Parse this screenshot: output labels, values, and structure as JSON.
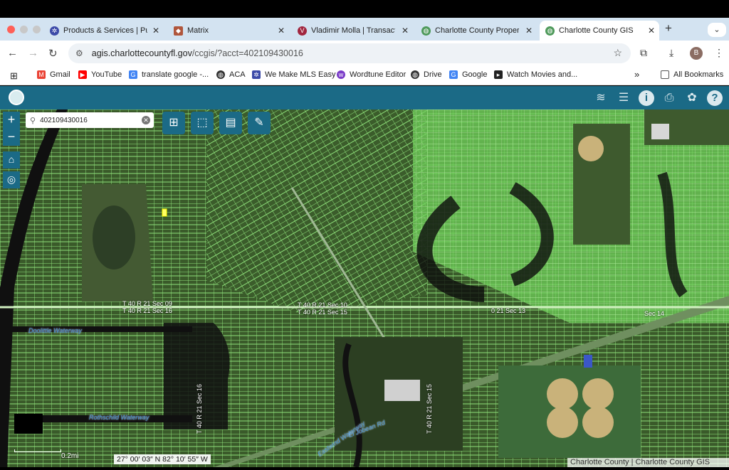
{
  "browser": {
    "tabs": [
      {
        "title": "Products & Services | Pun",
        "favicon": "gear-icon",
        "active": false
      },
      {
        "title": "Matrix",
        "favicon": "cube-icon",
        "active": false
      },
      {
        "title": "Vladimir Molla | Transactic",
        "favicon": "v-logo-icon",
        "active": false
      },
      {
        "title": "Charlotte County Propert",
        "favicon": "globe-icon",
        "active": false
      },
      {
        "title": "Charlotte County GIS",
        "favicon": "globe-icon",
        "active": true
      }
    ],
    "new_tab_label": "+",
    "tab_menu_label": "⌄",
    "url_domain": "agis.charlottecountyfl.gov",
    "url_path": "/ccgis/?acct=402109430016",
    "profile_initial": "B",
    "bookmarks": [
      {
        "label": "Gmail",
        "icon": "gmail-icon",
        "color": "#ea4335"
      },
      {
        "label": "YouTube",
        "icon": "youtube-icon",
        "color": "#ff0000"
      },
      {
        "label": "translate google -...",
        "icon": "google-icon",
        "color": "#4285f4"
      },
      {
        "label": "ACA",
        "icon": "globe-icon",
        "color": "#333333"
      },
      {
        "label": "We Make MLS Easy",
        "icon": "gear-icon",
        "color": "#3c4aa8"
      },
      {
        "label": "Wordtune Editor",
        "icon": "wordtune-icon",
        "color": "#7a3cc8"
      },
      {
        "label": "Drive",
        "icon": "globe-icon",
        "color": "#333333"
      },
      {
        "label": "Google",
        "icon": "google-icon",
        "color": "#4285f4"
      },
      {
        "label": "Watch Movies and...",
        "icon": "play-icon",
        "color": "#222222"
      }
    ],
    "bookmarks_overflow": "»",
    "all_bookmarks_label": "All Bookmarks"
  },
  "gis": {
    "search_value": "402109430016",
    "header_color": "#1b6a86",
    "zoom_in": "+",
    "zoom_out": "−",
    "scale_label": "0.2mi",
    "coordinates": "27° 00′ 03″ N 82° 10′ 55″ W",
    "attribution": "Charlotte County | Charlotte County GIS",
    "map_labels": {
      "sec9": "T 40 R 21 Sec 09",
      "sec9b": "T 40 R 21 Sec 16",
      "sec10": "T 40 R 21 Sec 10",
      "sec15": "T 40 R 21 Sec 15",
      "sec14": "Sec 14",
      "sec13": "0 21 Sec 13",
      "doolittle": "Doolittle Waterway",
      "rothschild": "Rothschild Waterway",
      "el_jobean": "El Jobean Rd",
      "eastwind": "Eastwind Waterway",
      "sec15b": "T 40 R 21 Sec 15",
      "sec16b": "T 40 R 21 Sec 16"
    }
  }
}
